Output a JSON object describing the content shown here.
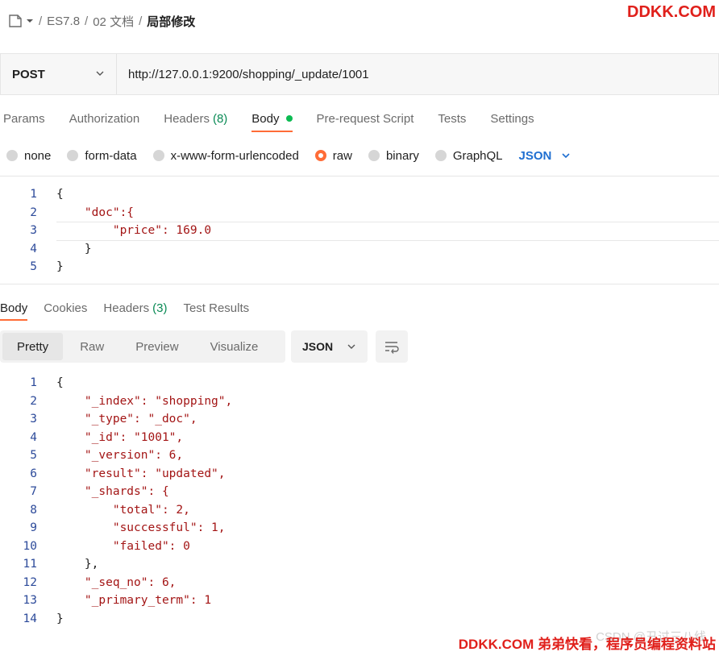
{
  "breadcrumb": {
    "items": [
      "ES7.8",
      "02 文档"
    ],
    "current": "局部修改",
    "separator": "/"
  },
  "watermark_top": "DDKK.COM",
  "request": {
    "method": "POST",
    "url": "http://127.0.0.1:9200/shopping/_update/1001"
  },
  "tabs": {
    "params": "Params",
    "authorization": "Authorization",
    "headers": "Headers",
    "headers_count": "(8)",
    "body": "Body",
    "prerequest": "Pre-request Script",
    "tests": "Tests",
    "settings": "Settings"
  },
  "body_types": {
    "none": "none",
    "form_data": "form-data",
    "urlencoded": "x-www-form-urlencoded",
    "raw": "raw",
    "binary": "binary",
    "graphql": "GraphQL",
    "format": "JSON"
  },
  "request_body_lines": [
    {
      "n": "1",
      "t": "{"
    },
    {
      "n": "2",
      "t": "    \"doc\":{"
    },
    {
      "n": "3",
      "t": "        \"price\": 169.0"
    },
    {
      "n": "4",
      "t": "    }"
    },
    {
      "n": "5",
      "t": "}"
    }
  ],
  "response_tabs": {
    "body": "Body",
    "cookies": "Cookies",
    "headers": "Headers",
    "headers_count": "(3)",
    "test_results": "Test Results"
  },
  "view_modes": {
    "pretty": "Pretty",
    "raw": "Raw",
    "preview": "Preview",
    "visualize": "Visualize",
    "format": "JSON"
  },
  "response_lines": [
    {
      "n": "1",
      "t": "{"
    },
    {
      "n": "2",
      "t": "    \"_index\": \"shopping\","
    },
    {
      "n": "3",
      "t": "    \"_type\": \"_doc\","
    },
    {
      "n": "4",
      "t": "    \"_id\": \"1001\","
    },
    {
      "n": "5",
      "t": "    \"_version\": 6,"
    },
    {
      "n": "6",
      "t": "    \"result\": \"updated\","
    },
    {
      "n": "7",
      "t": "    \"_shards\": {"
    },
    {
      "n": "8",
      "t": "        \"total\": 2,"
    },
    {
      "n": "9",
      "t": "        \"successful\": 1,"
    },
    {
      "n": "10",
      "t": "        \"failed\": 0"
    },
    {
      "n": "11",
      "t": "    },"
    },
    {
      "n": "12",
      "t": "    \"_seq_no\": 6,"
    },
    {
      "n": "13",
      "t": "    \"_primary_term\": 1"
    },
    {
      "n": "14",
      "t": "}"
    }
  ],
  "watermark_csdn": "CSDN @丑过三八线",
  "watermark_bottom": "DDKK.COM 弟弟快看，程序员编程资料站",
  "colors": {
    "accent": "#ff6c37",
    "green_dot": "#0cbb52",
    "json_blue": "#1f6fd1",
    "watermark_red": "#e0201b"
  }
}
